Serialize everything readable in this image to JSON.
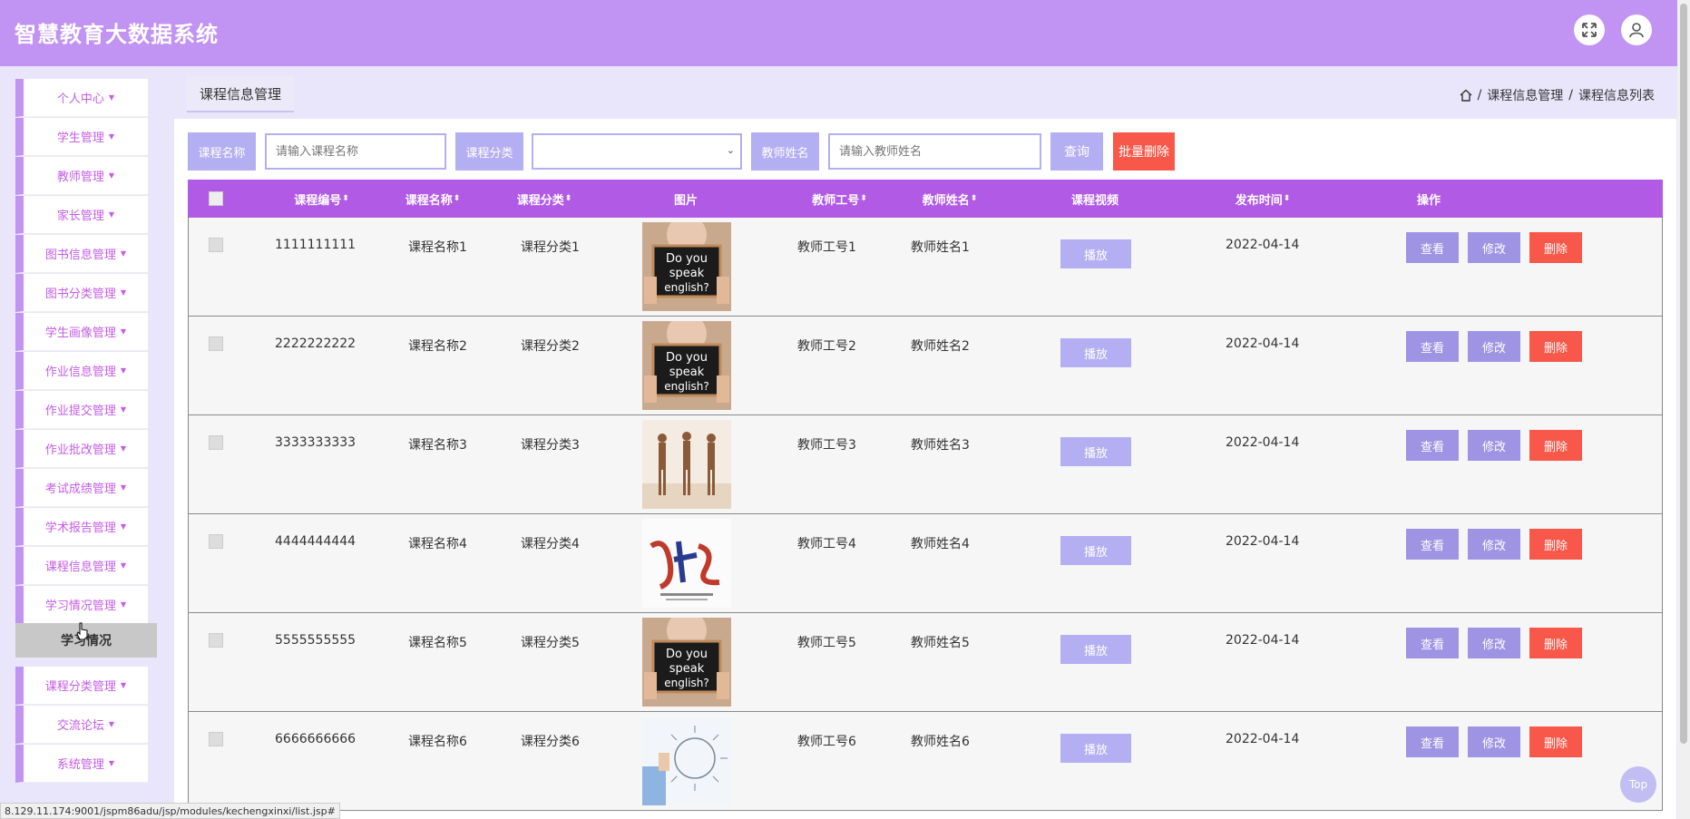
{
  "app": {
    "title": "智慧教育大数据系统"
  },
  "header": {
    "fullscreen_icon": "expand-icon",
    "user_icon": "user-icon"
  },
  "sidebar": {
    "items": [
      {
        "label": "个人中心"
      },
      {
        "label": "学生管理"
      },
      {
        "label": "教师管理"
      },
      {
        "label": "家长管理"
      },
      {
        "label": "图书信息管理"
      },
      {
        "label": "图书分类管理"
      },
      {
        "label": "学生画像管理"
      },
      {
        "label": "作业信息管理"
      },
      {
        "label": "作业提交管理"
      },
      {
        "label": "作业批改管理"
      },
      {
        "label": "考试成绩管理"
      },
      {
        "label": "学术报告管理"
      },
      {
        "label": "课程信息管理"
      },
      {
        "label": "学习情况管理"
      },
      {
        "label": "课程分类管理"
      },
      {
        "label": "交流论坛"
      },
      {
        "label": "系统管理"
      }
    ],
    "submenu_item": "学习情况"
  },
  "tabs": {
    "active": "课程信息管理"
  },
  "breadcrumb": {
    "home_icon": "home-icon",
    "sep": "/",
    "level1": "课程信息管理",
    "level2": "课程信息列表"
  },
  "search": {
    "course_name_label": "课程名称",
    "course_name_placeholder": "请输入课程名称",
    "category_label": "课程分类",
    "category_value": "",
    "teacher_name_label": "教师姓名",
    "teacher_name_placeholder": "请输入教师姓名",
    "query_button": "查询",
    "bulk_delete_button": "批量删除"
  },
  "table": {
    "headers": {
      "course_no": "课程编号",
      "course_name": "课程名称",
      "category": "课程分类",
      "image": "图片",
      "teacher_no": "教师工号",
      "teacher_name": "教师姓名",
      "video": "课程视频",
      "publish_time": "发布时间",
      "actions": "操作"
    },
    "sort_icon": "⬍",
    "play_label": "播放",
    "view_label": "查看",
    "edit_label": "修改",
    "delete_label": "删除",
    "rows": [
      {
        "course_no": "1111111111",
        "course_name": "课程名称1",
        "category": "课程分类1",
        "image": "speak-english-sign",
        "teacher_no": "教师工号1",
        "teacher_name": "教师姓名1",
        "publish_time": "2022-04-14"
      },
      {
        "course_no": "2222222222",
        "course_name": "课程名称2",
        "category": "课程分类2",
        "image": "speak-english-sign",
        "teacher_no": "教师工号2",
        "teacher_name": "教师姓名2",
        "publish_time": "2022-04-14"
      },
      {
        "course_no": "3333333333",
        "course_name": "课程名称3",
        "category": "课程分类3",
        "image": "dancers",
        "teacher_no": "教师工号3",
        "teacher_name": "教师姓名3",
        "publish_time": "2022-04-14"
      },
      {
        "course_no": "4444444444",
        "course_name": "课程名称4",
        "category": "课程分类4",
        "image": "calligraphy-poster",
        "teacher_no": "教师工号4",
        "teacher_name": "教师姓名4",
        "publish_time": "2022-04-14"
      },
      {
        "course_no": "5555555555",
        "course_name": "课程名称5",
        "category": "课程分类5",
        "image": "speak-english-sign",
        "teacher_no": "教师工号5",
        "teacher_name": "教师姓名5",
        "publish_time": "2022-04-14"
      },
      {
        "course_no": "6666666666",
        "course_name": "课程名称6",
        "category": "课程分类6",
        "image": "business-training",
        "teacher_no": "教师工号6",
        "teacher_name": "教师姓名6",
        "publish_time": "2022-04-14"
      }
    ]
  },
  "status_bar": {
    "url": "8.129.11.174:9001/jspm86adu/jsp/modules/kechengxinxi/list.jsp#"
  },
  "back_to_top": "Top",
  "colors": {
    "header": "#c193f3",
    "accent": "#b4aef2",
    "table_head": "#b15ae6",
    "danger": "#f7584a",
    "sidebar_text": "#c45ce6"
  }
}
